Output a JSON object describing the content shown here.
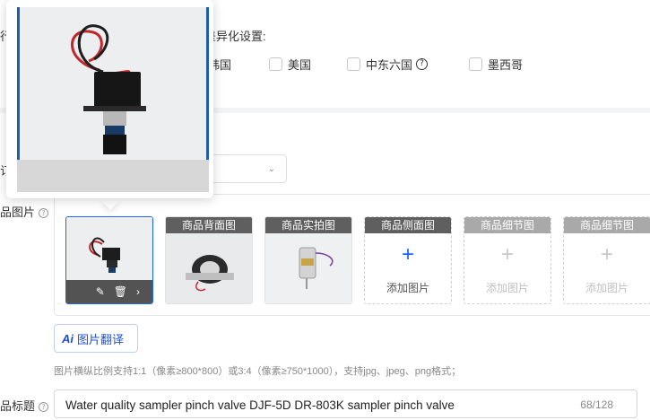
{
  "top_section": {
    "left_cut_label": "行",
    "diff_setting_label": "差异化设置:",
    "countries": [
      {
        "label": "韩国",
        "checked": false
      },
      {
        "label": "美国",
        "checked": false
      },
      {
        "label": "中东六国",
        "checked": false,
        "has_help": true,
        "help_glyph": "?"
      },
      {
        "label": "墨西哥",
        "checked": false
      }
    ]
  },
  "middle_section": {
    "left_cut_label": "订",
    "select_value": "",
    "select_chevron": "⌄"
  },
  "images_section": {
    "left_cut_label": "品图片",
    "help_glyph": "?",
    "main_thumb": {
      "edit_icon": "✎",
      "delete_icon": "🗑",
      "next_icon": "›"
    },
    "slots": [
      {
        "header": "商品背面图",
        "filled": true
      },
      {
        "header": "商品实拍图",
        "filled": true
      },
      {
        "header": "商品侧面图",
        "filled": false,
        "active": true,
        "plus": "+",
        "add_label": "添加图片"
      },
      {
        "header": "商品细节图",
        "filled": false,
        "active": false,
        "plus": "+",
        "add_label": "添加图片"
      },
      {
        "header": "商品细节图",
        "filled": false,
        "active": false,
        "plus": "+",
        "add_label": "添加图片"
      }
    ],
    "translate_button": {
      "ai_badge": "Ai",
      "label": "图片翻译"
    },
    "hint": "图片横纵比例支持1:1（像素≥800*800）或3:4（像素≥750*1000），支持jpg、jpeg、png格式；"
  },
  "title_section": {
    "left_cut_label": "品标题",
    "help_glyph": "?",
    "value": "Water quality sampler pinch valve DJF-5D DR-803K sampler pinch valve",
    "counter": "68/128"
  },
  "colors": {
    "accent": "#1a66ff",
    "slot_header": "#5f5f5f",
    "slot_header_faded": "#a9a9a9",
    "border": "#d6d6d6",
    "band": "#f3f4f6"
  }
}
